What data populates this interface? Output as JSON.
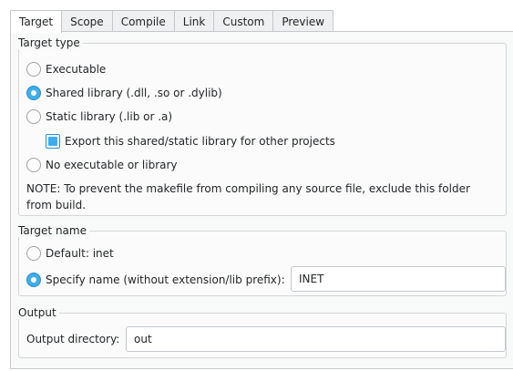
{
  "tabs": [
    {
      "label": "Target",
      "active": true
    },
    {
      "label": "Scope",
      "active": false
    },
    {
      "label": "Compile",
      "active": false
    },
    {
      "label": "Link",
      "active": false
    },
    {
      "label": "Custom",
      "active": false
    },
    {
      "label": "Preview",
      "active": false
    }
  ],
  "target_type": {
    "title": "Target type",
    "options": [
      {
        "label": "Executable",
        "checked": false
      },
      {
        "label": "Shared library (.dll, .so or .dylib)",
        "checked": true
      },
      {
        "label": "Static library (.lib or .a)",
        "checked": false
      }
    ],
    "export_checkbox": {
      "label": "Export this shared/static library for other projects",
      "checked": true
    },
    "no_executable": {
      "label": "No executable or library",
      "checked": false
    },
    "note": "NOTE: To prevent the makefile from compiling any source file, exclude this folder from build."
  },
  "target_name": {
    "title": "Target name",
    "default_option": {
      "label": "Default: inet",
      "checked": false
    },
    "specify_option": {
      "label": "Specify name (without extension/lib prefix):",
      "checked": true
    },
    "name_value": "INET"
  },
  "output": {
    "title": "Output",
    "directory_label": "Output directory:",
    "directory_value": "out"
  },
  "colors": {
    "accent": "#3daee9",
    "border": "#c4c8cc"
  }
}
